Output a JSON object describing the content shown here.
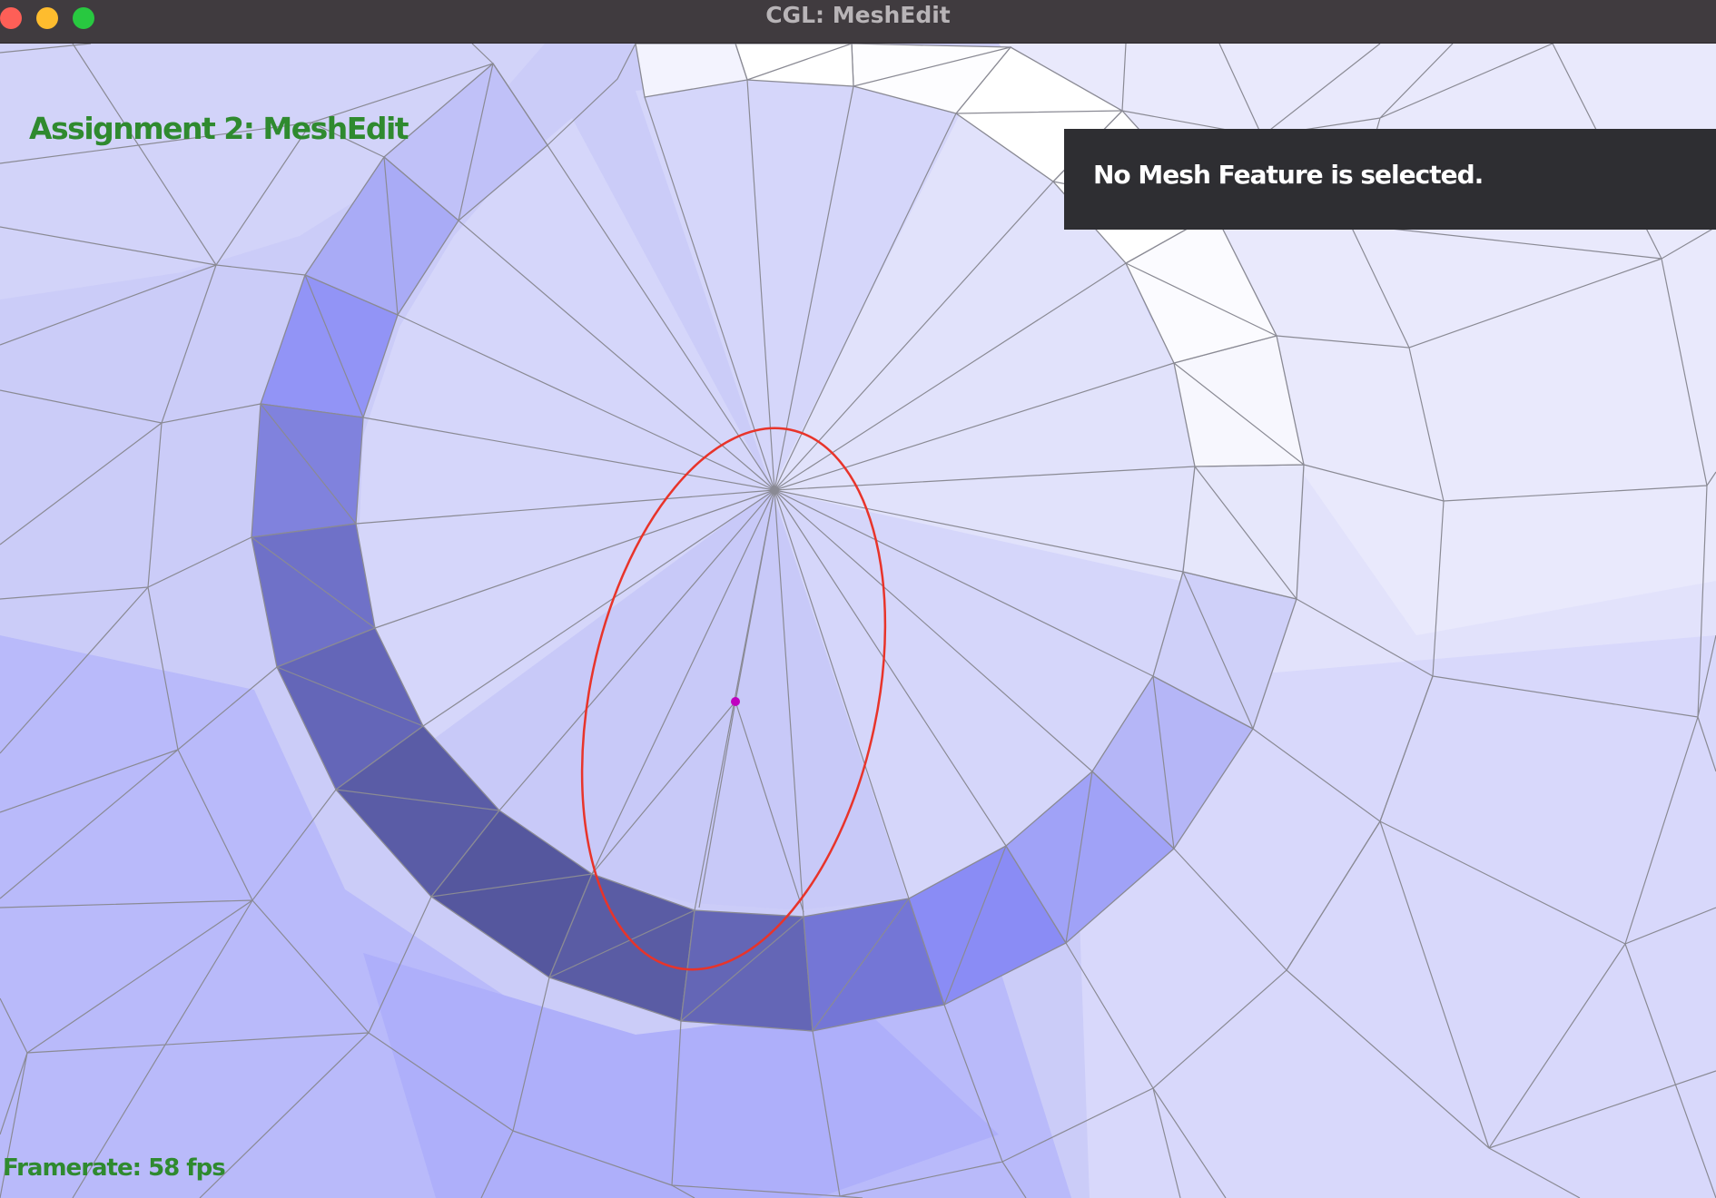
{
  "window": {
    "title": "CGL: MeshEdit",
    "controls": [
      "close",
      "minimize",
      "maximize"
    ]
  },
  "hud": {
    "assignment_title": "Assignment 2: MeshEdit",
    "framerate": "Framerate: 58 fps"
  },
  "info_panel": {
    "message": "No Mesh Feature is selected."
  },
  "colors": {
    "titlebar": "#403b3f",
    "hud_text": "#2f8a2f",
    "panel_bg": "#2e2e32",
    "edge": "#8a8a94",
    "cursor_ellipse": "#e8342a",
    "cursor_dot": "#c000c0"
  }
}
